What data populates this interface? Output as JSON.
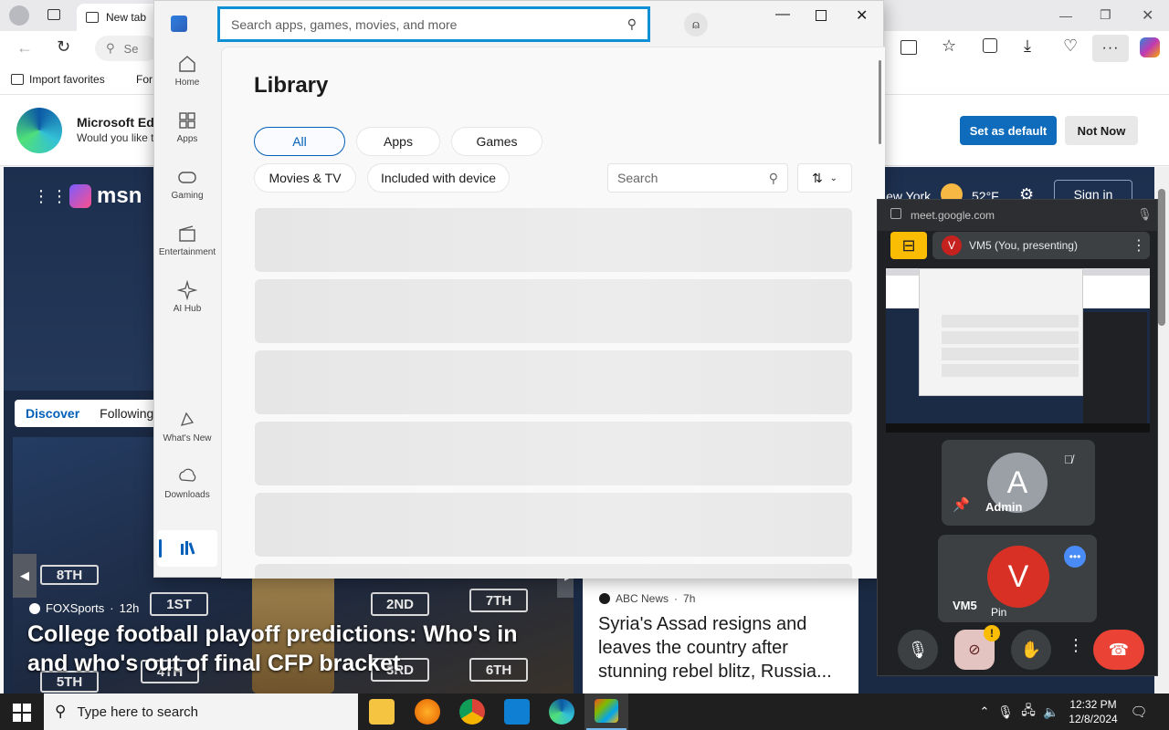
{
  "edge": {
    "tab_title": "New tab",
    "address_placeholder": "Se",
    "favorites": {
      "import_label": "Import favorites",
      "folder_label": "For"
    },
    "banner": {
      "title": "Microsoft Edg",
      "subtitle": "Would you like t",
      "set_default_label": "Set as default",
      "not_now_label": "Not Now"
    },
    "msn": {
      "logo_text": "msn",
      "weather_city": "New York",
      "weather_temp": "52°F",
      "sign_in_label": "Sign in",
      "feed_tabs": [
        "Discover",
        "Following"
      ],
      "hero_story": {
        "source": "FOXSports",
        "age": "12h",
        "headline": "College football playoff predictions: Who's in and who's out of final CFP bracket",
        "rank_labels": [
          "1ST",
          "2ND",
          "7TH",
          "3RD",
          "4TH",
          "5TH",
          "6TH",
          "8TH"
        ]
      },
      "side_story": {
        "source": "ABC News",
        "age": "7h",
        "headline": "Syria's Assad resigns and leaves the country after stunning rebel blitz, Russia..."
      }
    }
  },
  "store": {
    "search_placeholder": "Search apps, games, movies, and more",
    "nav": [
      {
        "label": "Home",
        "icon": "home-icon"
      },
      {
        "label": "Apps",
        "icon": "apps-icon"
      },
      {
        "label": "Gaming",
        "icon": "gaming-icon"
      },
      {
        "label": "Entertainment",
        "icon": "entertainment-icon"
      },
      {
        "label": "AI Hub",
        "icon": "ai-hub-icon"
      }
    ],
    "nav_bottom": [
      {
        "label": "What's New",
        "icon": "whats-new-icon"
      },
      {
        "label": "Downloads",
        "icon": "downloads-icon"
      }
    ],
    "page_title": "Library",
    "filters": [
      "All",
      "Apps",
      "Games",
      "Movies & TV",
      "Included with device"
    ],
    "active_filter": "All",
    "library_search_placeholder": "Search",
    "placeholder_rows": 6,
    "accent": "#005fb8"
  },
  "meet": {
    "url": "meet.google.com",
    "presenter_initial": "V",
    "presenter_label": "VM5 (You, presenting)",
    "participants": [
      {
        "initial": "A",
        "name": "Admin",
        "color": "#9aa0a6"
      },
      {
        "initial": "V",
        "name": "VM5",
        "color": "#d93025",
        "pin_label": "Pin"
      }
    ]
  },
  "taskbar": {
    "search_placeholder": "Type here to search",
    "time": "12:32 PM",
    "date": "12/8/2024"
  }
}
